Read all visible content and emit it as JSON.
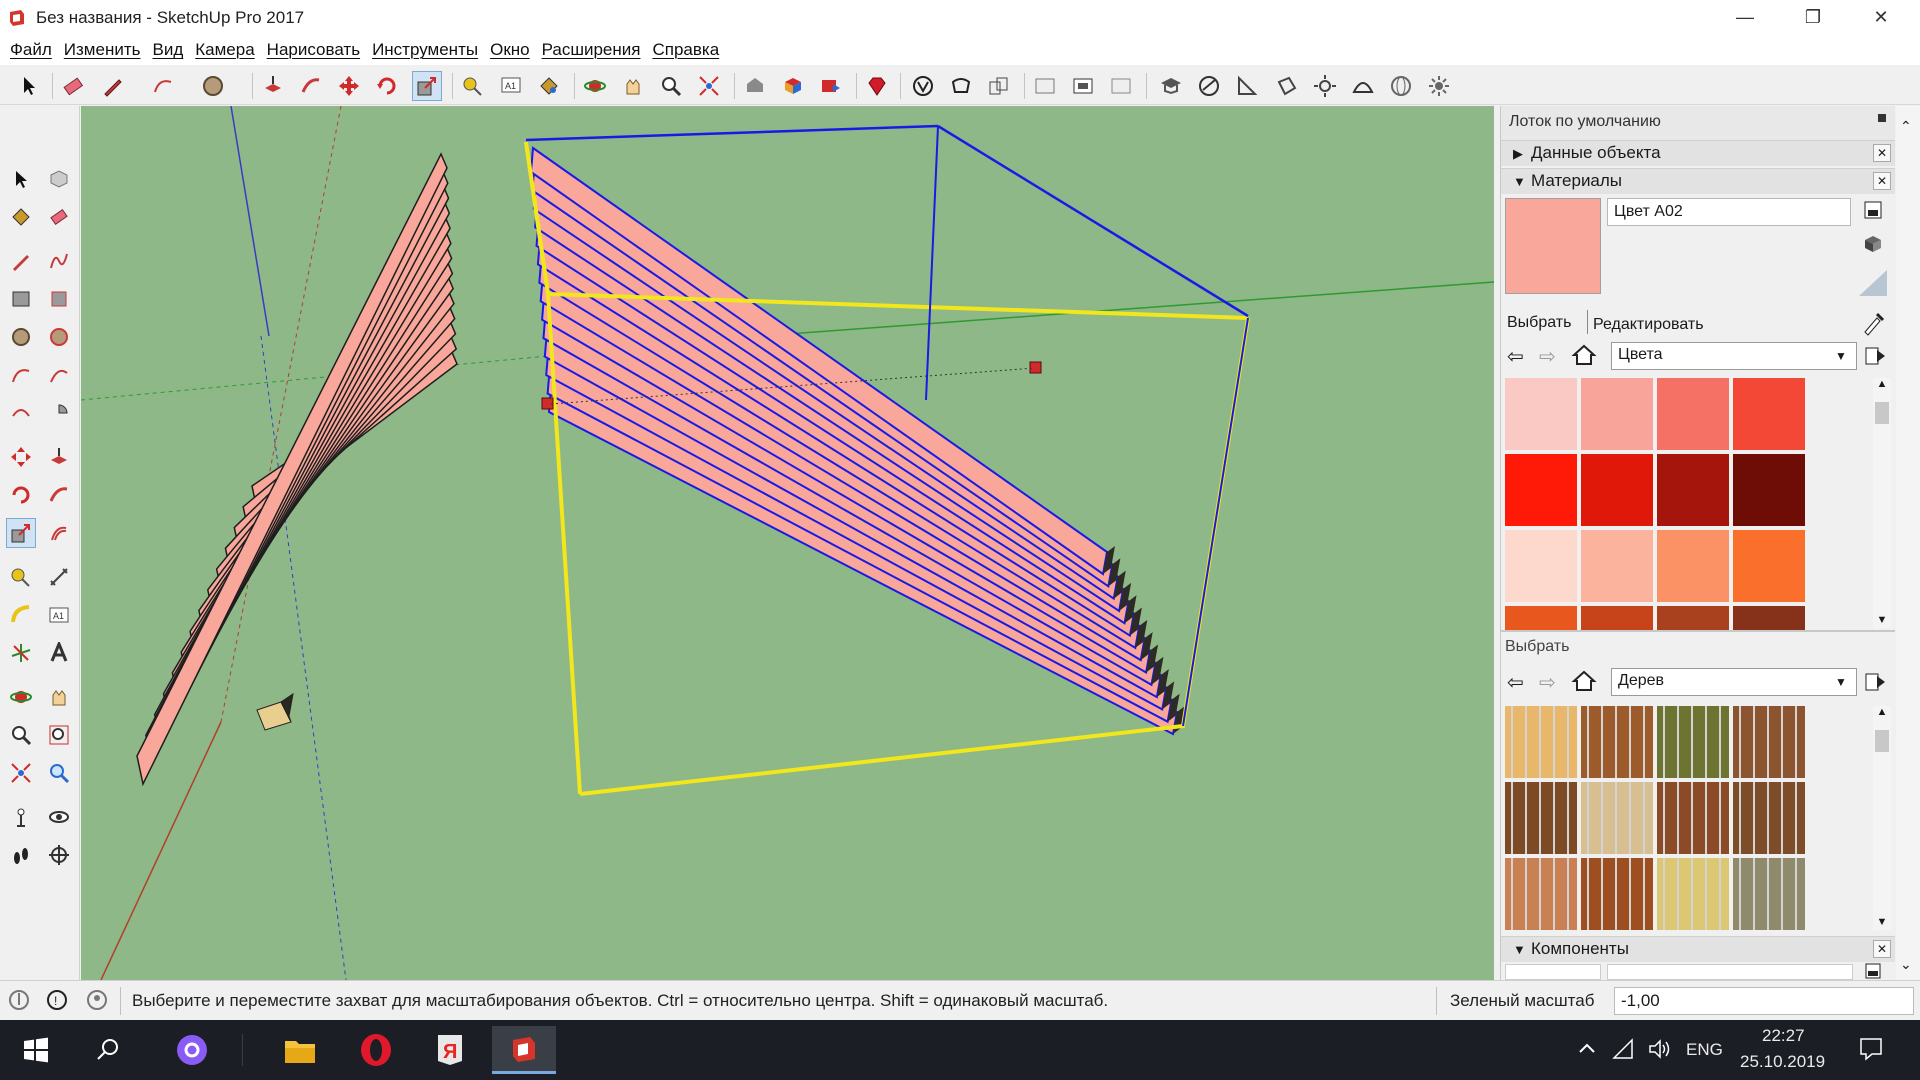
{
  "window": {
    "title": "Без названия - SketchUp Pro 2017",
    "controls": [
      "minimize",
      "restore",
      "close"
    ]
  },
  "menu": [
    "Файл",
    "Изменить",
    "Вид",
    "Камера",
    "Нарисовать",
    "Инструменты",
    "Окно",
    "Расширения",
    "Справка"
  ],
  "toolbar": {
    "active_tool": "scale-icon"
  },
  "tray": {
    "title": "Лоток по умолчанию",
    "panels": {
      "entity_info": "Данные объекта",
      "materials": "Материалы",
      "components": "Компоненты"
    },
    "material": {
      "name": "Цвет A02",
      "color": "#f9a79a",
      "tab_select": "Выбрать",
      "tab_edit": "Редактировать",
      "library": "Цвета",
      "colors": [
        "#fbc9c3",
        "#f9a49a",
        "#f67165",
        "#f44837",
        "#fe1a07",
        "#df1809",
        "#a6150b",
        "#6e0d06",
        "#fdd9cd",
        "#fcb39d",
        "#fa9266",
        "#fb6f2c"
      ],
      "partial_row": [
        "#e8571d",
        "#c7441b",
        "#a9401e",
        "#86321b"
      ]
    },
    "secondary": {
      "label": "Выбрать",
      "library": "Дерев",
      "textures": [
        "#e8b76a",
        "#9d5a2a",
        "#6d7432",
        "#8d5430",
        "#7d4a26",
        "#d8bf92",
        "#8b4b27",
        "#7d4d2a",
        "#c98052",
        "#9e4f22",
        "#dcc773",
        "#8f8a6c"
      ]
    }
  },
  "status": {
    "hint": "Выберите и переместите захват для масштабирования объектов. Ctrl = относительно центра. Shift = одинаковый масштаб.",
    "measure_label": "Зеленый масштаб",
    "measure_value": "-1,00"
  },
  "taskbar": {
    "language": "ENG",
    "time": "22:27",
    "date": "25.10.2019"
  },
  "colors": {
    "viewport_bg": "#8fb888",
    "rafter_face": "#f9a79a",
    "selection_blue": "#1a1ae6",
    "scale_box_yellow": "#f2e61c",
    "axis_green": "#2f9a2f",
    "axis_red": "#b0402a",
    "axis_blue": "#3a3ac8"
  }
}
